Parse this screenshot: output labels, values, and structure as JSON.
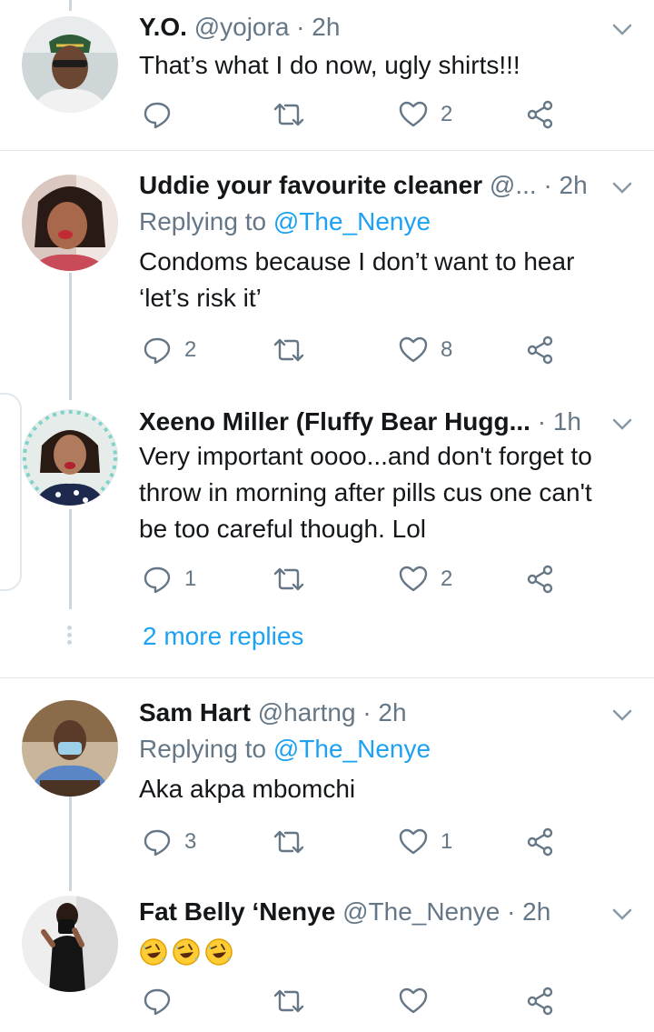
{
  "tweets": [
    {
      "name": "Y.O.",
      "handle": "@yojora",
      "time": "· 2h",
      "reply_to_label": "",
      "reply_to_handle": "",
      "text_lines": [
        "That’s what I do now, ugly shirts!!!"
      ],
      "replies": "",
      "likes": "2"
    },
    {
      "name": "Uddie your favourite cleaner",
      "handle": "@...",
      "time": "· 2h",
      "reply_to_label": "Replying to",
      "reply_to_handle": "@The_Nenye",
      "text_lines": [
        "Condoms because I don’t want to hear",
        "‘let’s risk it’"
      ],
      "replies": "2",
      "likes": "8"
    },
    {
      "name": "Xeeno Miller (Fluffy Bear Hugg...",
      "handle": "",
      "time": "· 1h",
      "reply_to_label": "",
      "reply_to_handle": "",
      "text_lines": [
        "Very important oooo...and don't forget to",
        "throw in morning after pills cus one can't",
        "be too careful though. Lol"
      ],
      "replies": "1",
      "likes": "2"
    },
    {
      "name": "Sam Hart",
      "handle": "@hartng",
      "time": "· 2h",
      "reply_to_label": "Replying to",
      "reply_to_handle": "@The_Nenye",
      "text_lines": [
        "Aka akpa mbomchi"
      ],
      "replies": "3",
      "likes": "1"
    },
    {
      "name": "Fat Belly ‘Nenye",
      "handle": "@The_Nenye",
      "time": "· 2h",
      "reply_to_label": "",
      "reply_to_handle": "",
      "text_lines": [],
      "emojis": [
        "rolling-on-floor-laughing",
        "rolling-on-floor-laughing",
        "rolling-on-floor-laughing"
      ],
      "replies": "",
      "likes": ""
    }
  ],
  "more_replies": "2 more replies",
  "colors": {
    "text": "#14171a",
    "secondary": "#657786",
    "link": "#1da1f2",
    "divider": "#e1e8ed",
    "thread": "#ccd6dd"
  },
  "icons": [
    "reply-icon",
    "retweet-icon",
    "like-icon",
    "share-icon",
    "chevron-down-icon"
  ]
}
